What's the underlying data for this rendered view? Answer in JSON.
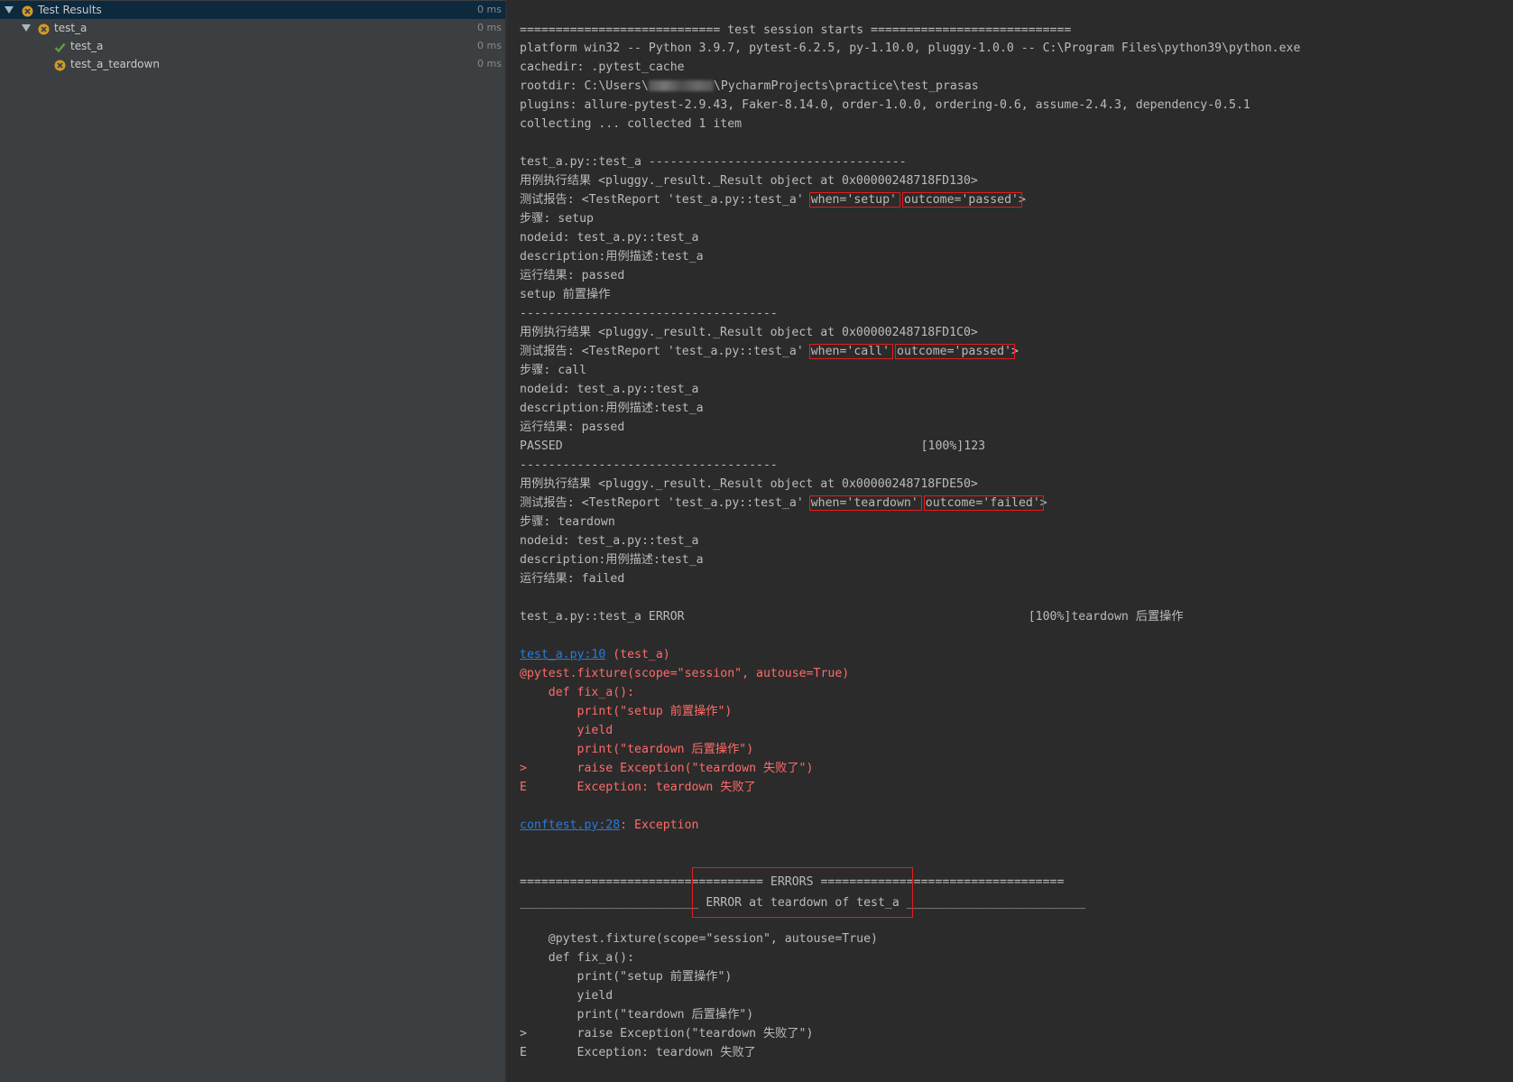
{
  "tree": {
    "root": {
      "label": "Test Results",
      "duration": "0 ms",
      "status_icon": "error-icon"
    },
    "suite": {
      "label": "test_a",
      "duration": "0 ms",
      "status_icon": "error-icon"
    },
    "tests": [
      {
        "label": "test_a",
        "duration": "0 ms",
        "status_icon": "check-icon"
      },
      {
        "label": "test_a_teardown",
        "duration": "0 ms",
        "status_icon": "error-icon"
      }
    ]
  },
  "console": {
    "session_header": "============================ test session starts ============================",
    "platform": "platform win32 -- Python 3.9.7, pytest-6.2.5, py-1.10.0, pluggy-1.0.0 -- C:\\Program Files\\python39\\python.exe",
    "cachedir": "cachedir: .pytest_cache",
    "rootdir_prefix": "rootdir: C:\\Users\\",
    "rootdir_suffix": "\\PycharmProjects\\practice\\test_prasas",
    "plugins": "plugins: allure-pytest-2.9.43, Faker-8.14.0, order-1.0.0, ordering-0.6, assume-2.4.3, dependency-0.5.1",
    "collecting": "collecting ... collected 1 item",
    "test_header": "test_a.py::test_a ------------------------------------",
    "setup": {
      "result": "用例执行结果 <pluggy._result._Result object at 0x00000248718FD130>",
      "report_prefix": "测试报告: <TestReport 'test_a.py::test_a' ",
      "when": "when='setup'",
      "outcome": "outcome='passed'",
      "close": ">",
      "step": "步骤: setup",
      "nodeid": "nodeid: test_a.py::test_a",
      "description": "description:用例描述:test_a",
      "run_result": "运行结果: passed",
      "extra": "setup 前置操作"
    },
    "separator": "------------------------------------",
    "call": {
      "result": "用例执行结果 <pluggy._result._Result object at 0x00000248718FD1C0>",
      "report_prefix": "测试报告: <TestReport 'test_a.py::test_a' ",
      "when": "when='call'",
      "outcome": "outcome='passed'",
      "close": ">",
      "step": "步骤: call",
      "nodeid": "nodeid: test_a.py::test_a",
      "description": "description:用例描述:test_a",
      "run_result": "运行结果: passed",
      "passed_line": "PASSED                                                  [100%]123"
    },
    "teardown": {
      "result": "用例执行结果 <pluggy._result._Result object at 0x00000248718FDE50>",
      "report_prefix": "测试报告: <TestReport 'test_a.py::test_a' ",
      "when": "when='teardown'",
      "outcome": "outcome='failed'",
      "close": ">",
      "step": "步骤: teardown",
      "nodeid": "nodeid: test_a.py::test_a",
      "description": "description:用例描述:test_a",
      "run_result": "运行结果: failed"
    },
    "error_line": "test_a.py::test_a ERROR                                                [100%]teardown 后置操作",
    "trace_link": "test_a.py:10",
    "trace_context": " (test_a)",
    "code": [
      "@pytest.fixture(scope=\"session\", autouse=True)",
      "    def fix_a():",
      "        print(\"setup 前置操作\")",
      "        yield",
      "        print(\"teardown 后置操作\")",
      ">       raise Exception(\"teardown 失败了\")",
      "E       Exception: teardown 失败了"
    ],
    "conftest_link": "conftest.py:28",
    "conftest_suffix": ": Exception",
    "errors_header": "================================== ERRORS ==================================",
    "error_at": "_________________________ ERROR at teardown of test_a _________________________",
    "code2": [
      "    @pytest.fixture(scope=\"session\", autouse=True)",
      "    def fix_a():",
      "        print(\"setup 前置操作\")",
      "        yield",
      "        print(\"teardown 后置操作\")",
      ">       raise Exception(\"teardown 失败了\")",
      "E       Exception: teardown 失败了"
    ]
  },
  "colors": {
    "panel_bg": "#3c3f41",
    "console_bg": "#2b2b2b",
    "selected_row": "#0d293e",
    "error_text": "#ff6b68",
    "link": "#287bde",
    "highlight_box": "#e21d1d",
    "pass_icon": "#5f9f3f",
    "error_icon": "#d19a27"
  }
}
